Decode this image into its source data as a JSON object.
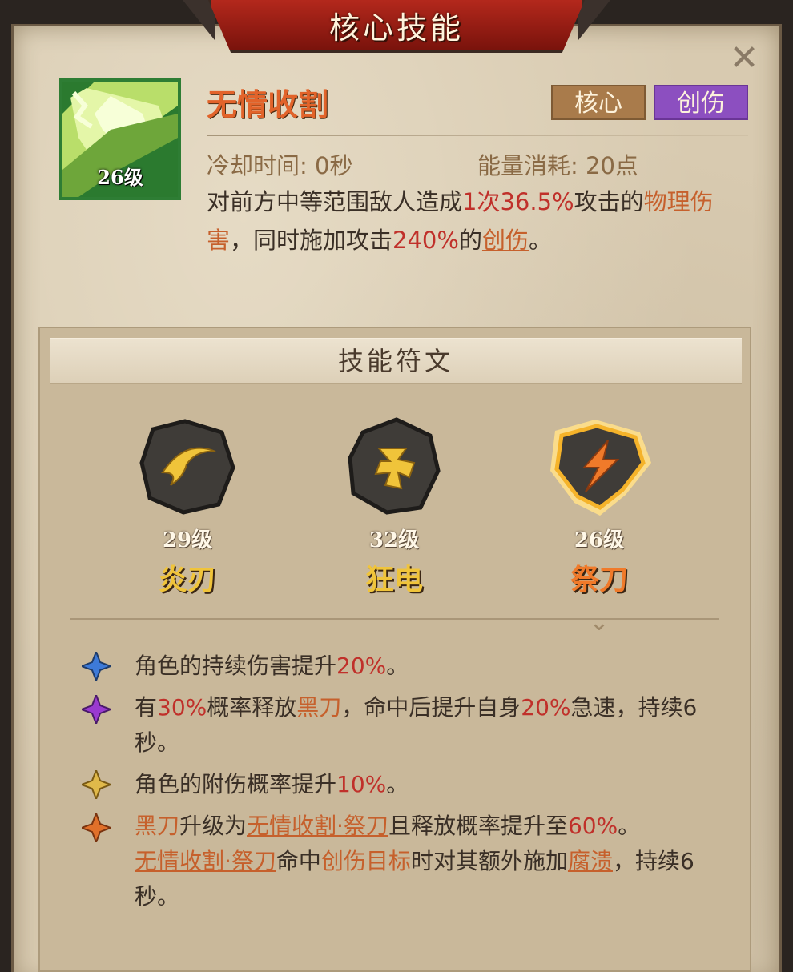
{
  "window": {
    "title": "核心技能"
  },
  "skill": {
    "name": "无情收割",
    "level": "26级",
    "tags": [
      "核心",
      "创伤"
    ],
    "cooldown": "冷却时间: 0秒",
    "energy": "能量消耗: 20点",
    "description": {
      "p1": "对前方中等范围敌人造成",
      "p2": "1次",
      "p3": "36.5%",
      "p4": "攻击的",
      "p5": "物理伤害",
      "p6": "，同时施加攻击",
      "p7": "240%",
      "p8": "的",
      "p9": "创伤",
      "p10": "。"
    }
  },
  "runes": {
    "header": "技能符文",
    "items": [
      {
        "level": "29级",
        "name": "炎刃",
        "icon": "crescent-icon",
        "color": "#f0c43a"
      },
      {
        "level": "32级",
        "name": "狂电",
        "icon": "shuriken-icon",
        "color": "#f0c43a"
      },
      {
        "level": "26级",
        "name": "祭刀",
        "icon": "lightning-icon",
        "color": "#f07a2a",
        "selected": true
      }
    ]
  },
  "effects": [
    {
      "star": "blue-star-icon",
      "parts": [
        "角色的持续伤害提升",
        "20%",
        "。"
      ]
    },
    {
      "star": "purple-star-icon",
      "parts": [
        "有",
        "30%",
        "概率释放",
        "黑刀",
        "，命中后提升自身",
        "20%",
        "急速，持续6秒。"
      ]
    },
    {
      "star": "gold-star-icon",
      "parts": [
        "角色的附伤概率提升",
        "10%",
        "。"
      ]
    },
    {
      "star": "orange-star-icon",
      "parts": [
        "黑刀",
        "升级为",
        "无情收割·祭刀",
        "且释放概率提升至",
        "60%",
        "。",
        "无情收割·祭刀",
        "命中",
        "创伤目标",
        "时对其额外施加",
        "腐溃",
        "，持续6秒。"
      ]
    }
  ],
  "colors": {
    "accent_red": "#c0302a",
    "accent_orange": "#c6602c",
    "tag_core": "#a97b4b",
    "tag_wound": "#8c4fc0"
  }
}
